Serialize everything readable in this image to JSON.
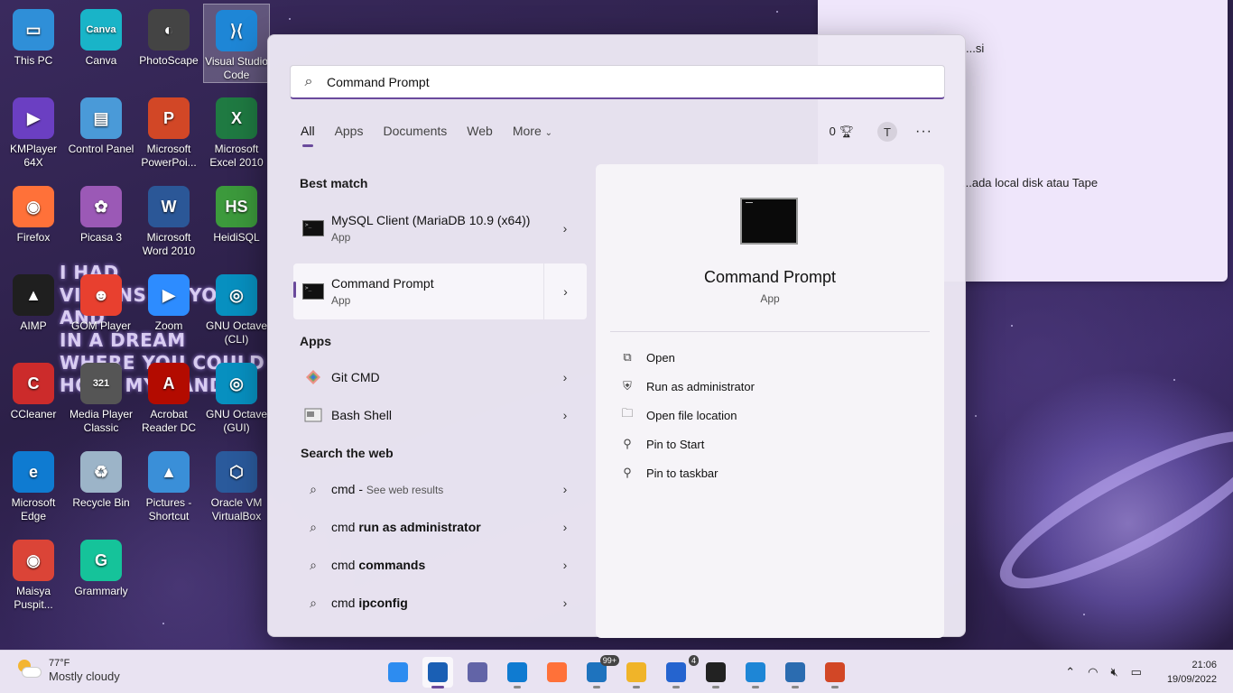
{
  "desktop": {
    "icons": [
      {
        "label": "This PC",
        "icon": "computer-icon",
        "color": "#2f8fd8",
        "glyph": "▭"
      },
      {
        "label": "Canva",
        "icon": "canva-icon",
        "color": "#19b4c8",
        "glyph": "Canva"
      },
      {
        "label": "PhotoScape",
        "icon": "photoscape-icon",
        "color": "#444444",
        "glyph": "◐"
      },
      {
        "label": "Visual Studio Code",
        "icon": "vscode-icon",
        "color": "#1e86d6",
        "glyph": "⟩⟨"
      },
      {
        "label": "KMPlayer 64X",
        "icon": "kmplayer-icon",
        "color": "#6b3fc2",
        "glyph": "▶"
      },
      {
        "label": "Control Panel",
        "icon": "control-panel-icon",
        "color": "#4a9ad8",
        "glyph": "▤"
      },
      {
        "label": "Microsoft PowerPoi...",
        "icon": "powerpoint-icon",
        "color": "#d24726",
        "glyph": "P"
      },
      {
        "label": "Microsoft Excel 2010",
        "icon": "excel-icon",
        "color": "#1f7a42",
        "glyph": "X"
      },
      {
        "label": "Firefox",
        "icon": "firefox-icon",
        "color": "#ff7139",
        "glyph": "◉"
      },
      {
        "label": "Picasa 3",
        "icon": "picasa-icon",
        "color": "#9b59b6",
        "glyph": "✿"
      },
      {
        "label": "Microsoft Word 2010",
        "icon": "word-icon",
        "color": "#2b5797",
        "glyph": "W"
      },
      {
        "label": "HeidiSQL",
        "icon": "heidisql-icon",
        "color": "#3c9a3c",
        "glyph": "HS"
      },
      {
        "label": "AIMP",
        "icon": "aimp-icon",
        "color": "#1f1f1f",
        "glyph": "▲"
      },
      {
        "label": "GOM Player",
        "icon": "gom-player-icon",
        "color": "#e8402f",
        "glyph": "☻"
      },
      {
        "label": "Zoom",
        "icon": "zoom-icon",
        "color": "#2d8cff",
        "glyph": "▶"
      },
      {
        "label": "GNU Octave (CLI)",
        "icon": "octave-icon",
        "color": "#0790c0",
        "glyph": "◎"
      },
      {
        "label": "CCleaner",
        "icon": "ccleaner-icon",
        "color": "#cc2b2b",
        "glyph": "C"
      },
      {
        "label": "Media Player Classic",
        "icon": "media-player-icon",
        "color": "#555555",
        "glyph": "321"
      },
      {
        "label": "Acrobat Reader DC",
        "icon": "acrobat-icon",
        "color": "#b30b00",
        "glyph": "A"
      },
      {
        "label": "GNU Octave (GUI)",
        "icon": "octave-gui-icon",
        "color": "#0790c0",
        "glyph": "◎"
      },
      {
        "label": "Microsoft Edge",
        "icon": "edge-icon",
        "color": "#0f7bd1",
        "glyph": "e"
      },
      {
        "label": "Recycle Bin",
        "icon": "recycle-bin-icon",
        "color": "#9cb4c8",
        "glyph": "♻"
      },
      {
        "label": "Pictures - Shortcut",
        "icon": "pictures-folder-icon",
        "color": "#3a8fd8",
        "glyph": "▲"
      },
      {
        "label": "Oracle VM VirtualBox",
        "icon": "virtualbox-icon",
        "color": "#2a5a9c",
        "glyph": "⬡"
      },
      {
        "label": "Maisya Puspit...",
        "icon": "chrome-icon",
        "color": "#db4437",
        "glyph": "◉"
      },
      {
        "label": "Grammarly",
        "icon": "grammarly-icon",
        "color": "#15c39a",
        "glyph": "G"
      }
    ],
    "graffiti": [
      "I HAD",
      "VISIONS OF YOU AND",
      "IN A DREAM",
      "WHERE YOU COULD",
      "HOLD MY HAND"
    ],
    "sticky_note": [
      "...si",
      "...ada local disk atau Tape"
    ]
  },
  "search": {
    "query": "Command Prompt",
    "filters": [
      "All",
      "Apps",
      "Documents",
      "Web",
      "More"
    ],
    "active_filter": "All",
    "points": "0",
    "avatar_letter": "T",
    "more_options": "···",
    "best_match_title": "Best match",
    "best_match": [
      {
        "name": "MySQL Client (MariaDB 10.9 (x64))",
        "type": "App"
      },
      {
        "name": "Command Prompt",
        "type": "App"
      }
    ],
    "apps_title": "Apps",
    "apps": [
      {
        "name": "Git CMD",
        "icon": "git-icon"
      },
      {
        "name": "Bash Shell",
        "icon": "bash-icon"
      }
    ],
    "web_title": "Search the web",
    "web": [
      {
        "prefix": "cmd",
        "suffix": "See web results",
        "bold": ""
      },
      {
        "prefix": "cmd",
        "suffix": "",
        "bold": "run as administrator"
      },
      {
        "prefix": "cmd",
        "suffix": "",
        "bold": "commands"
      },
      {
        "prefix": "cmd",
        "suffix": "",
        "bold": "ipconfig"
      }
    ],
    "detail": {
      "name": "Command Prompt",
      "type": "App",
      "actions": [
        {
          "label": "Open",
          "icon": "open-external-icon"
        },
        {
          "label": "Run as administrator",
          "icon": "shield-admin-icon"
        },
        {
          "label": "Open file location",
          "icon": "folder-icon"
        },
        {
          "label": "Pin to Start",
          "icon": "pin-icon"
        },
        {
          "label": "Pin to taskbar",
          "icon": "pin-icon"
        }
      ]
    }
  },
  "taskbar": {
    "weather_temp": "77°F",
    "weather_desc": "Mostly cloudy",
    "apps": [
      {
        "name": "start",
        "icon": "windows-start-icon",
        "color": "#2d8cf0"
      },
      {
        "name": "search",
        "icon": "search-icon",
        "color": "#1a5fb4"
      },
      {
        "name": "teams-chat",
        "icon": "chat-icon",
        "color": "#6264a7"
      },
      {
        "name": "edge",
        "icon": "edge-icon",
        "color": "#0f7bd1"
      },
      {
        "name": "firefox",
        "icon": "firefox-icon",
        "color": "#ff7139"
      },
      {
        "name": "mail",
        "icon": "mail-icon",
        "color": "#1e73be",
        "badge": "99+"
      },
      {
        "name": "file-explorer",
        "icon": "folder-icon",
        "color": "#f0b429"
      },
      {
        "name": "todo",
        "icon": "todo-icon",
        "color": "#2564cf",
        "badge": "4"
      },
      {
        "name": "sticky-notes",
        "icon": "sticky-notes-icon",
        "color": "#222222"
      },
      {
        "name": "vscode",
        "icon": "vscode-icon",
        "color": "#1e86d6"
      },
      {
        "name": "photos",
        "icon": "photos-icon",
        "color": "#2b6cb0"
      },
      {
        "name": "powerpoint",
        "icon": "powerpoint-icon",
        "color": "#d24726"
      }
    ],
    "time": "21:06",
    "date": "19/09/2022"
  }
}
